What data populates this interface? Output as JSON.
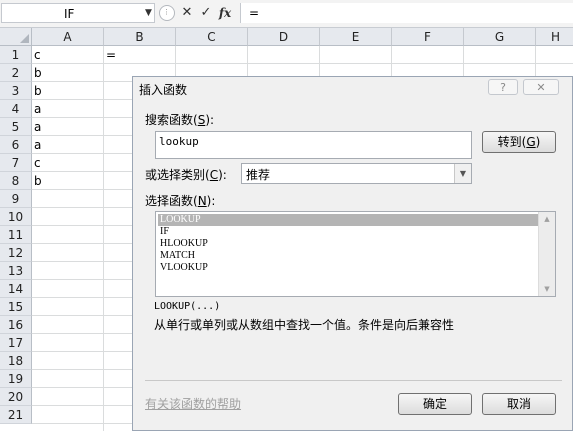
{
  "formula_bar": {
    "name_box": "IF",
    "cancel_glyph": "✕",
    "enter_glyph": "✓",
    "fx_glyph": "fx",
    "formula": "="
  },
  "sheet": {
    "columns": [
      "A",
      "B",
      "C",
      "D",
      "E",
      "F",
      "G",
      "H"
    ],
    "rows": [
      "1",
      "2",
      "3",
      "4",
      "5",
      "6",
      "7",
      "8",
      "9",
      "10",
      "11",
      "12",
      "13",
      "14",
      "15",
      "16",
      "17",
      "18",
      "19",
      "20",
      "21"
    ],
    "col_a_values": [
      "c",
      "b",
      "b",
      "a",
      "a",
      "a",
      "c",
      "b"
    ],
    "b1_value": "="
  },
  "dialog": {
    "title": "插入函数",
    "help_button": "?",
    "close_button": "✕",
    "search_label": "搜索函数(",
    "search_key": "S",
    "search_label_end": "):",
    "search_value": "lookup",
    "goto_button": "转到(",
    "goto_key": "G",
    "goto_end": ")",
    "category_label": "或选择类别(",
    "category_key": "C",
    "category_end": "):",
    "category_value": "推荐",
    "select_label": "选择函数(",
    "select_key": "N",
    "select_end": "):",
    "functions": [
      "LOOKUP",
      "IF",
      "HLOOKUP",
      "MATCH",
      "VLOOKUP"
    ],
    "signature": "LOOKUP(...)",
    "description": "从单行或单列或从数组中查找一个值。条件是向后兼容性",
    "help_link": "有关该函数的帮助",
    "ok_button": "确定",
    "cancel_button": "取消"
  }
}
